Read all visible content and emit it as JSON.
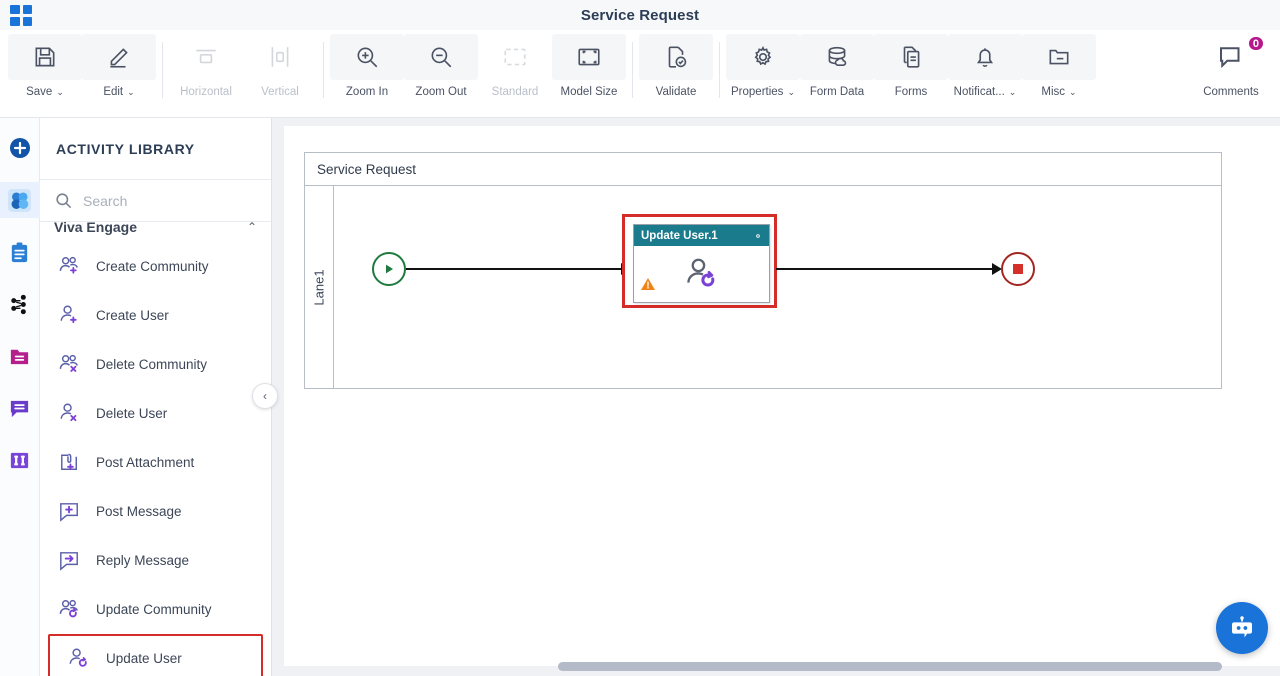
{
  "titlebar": {
    "title": "Service Request",
    "logo_icon": "app-grid-icon"
  },
  "toolbar": {
    "items": [
      {
        "label": "Save",
        "icon": "save-floppy-icon",
        "caret": "⌄",
        "disabled": false
      },
      {
        "label": "Edit",
        "icon": "pencil-icon",
        "caret": "⌄",
        "disabled": false
      },
      {
        "label": "Horizontal",
        "icon": "horizontal-align-icon",
        "caret": "",
        "disabled": true
      },
      {
        "label": "Vertical",
        "icon": "vertical-align-icon",
        "caret": "",
        "disabled": true
      },
      {
        "label": "Zoom In",
        "icon": "zoom-in-icon",
        "caret": "",
        "disabled": false
      },
      {
        "label": "Zoom Out",
        "icon": "zoom-out-icon",
        "caret": "",
        "disabled": false
      },
      {
        "label": "Standard",
        "icon": "standard-size-icon",
        "caret": "",
        "disabled": true
      },
      {
        "label": "Model Size",
        "icon": "model-size-icon",
        "caret": "",
        "disabled": false
      },
      {
        "label": "Validate",
        "icon": "validate-check-icon",
        "caret": "",
        "disabled": false
      },
      {
        "label": "Properties",
        "icon": "gear-icon",
        "caret": "⌄",
        "disabled": false
      },
      {
        "label": "Form Data",
        "icon": "database-cloud-icon",
        "caret": "",
        "disabled": false
      },
      {
        "label": "Forms",
        "icon": "document-copy-icon",
        "caret": "",
        "disabled": false
      },
      {
        "label": "Notificat...",
        "icon": "bell-icon",
        "caret": "⌄",
        "disabled": false
      },
      {
        "label": "Misc",
        "icon": "folder-minus-icon",
        "caret": "⌄",
        "disabled": false
      }
    ],
    "comments": {
      "label": "Comments",
      "icon": "comment-bubble-icon",
      "badge": "0",
      "badge_color": "#b6178d"
    }
  },
  "rail": {
    "items": [
      {
        "name": "add-new",
        "icon": "plus-circle-icon",
        "active": false
      },
      {
        "name": "community",
        "icon": "community-people-icon",
        "active": true
      },
      {
        "name": "tasks",
        "icon": "clipboard-icon",
        "active": false
      },
      {
        "name": "process",
        "icon": "workflow-nodes-icon",
        "active": false
      },
      {
        "name": "documents",
        "icon": "folder-icon",
        "active": false
      },
      {
        "name": "messages",
        "icon": "chat-bubble-icon",
        "active": false
      },
      {
        "name": "columns",
        "icon": "columns-icon",
        "active": false
      }
    ]
  },
  "panel": {
    "title": "ACTIVITY LIBRARY",
    "search": {
      "placeholder": "Search",
      "value": "",
      "icon": "search-icon"
    },
    "category": {
      "label": "Viva Engage",
      "chevron": "⌃"
    },
    "activities": [
      {
        "label": "Create Community",
        "icon": "create-community-icon",
        "selected": false
      },
      {
        "label": "Create User",
        "icon": "create-user-icon",
        "selected": false
      },
      {
        "label": "Delete Community",
        "icon": "delete-community-icon",
        "selected": false
      },
      {
        "label": "Delete User",
        "icon": "delete-user-icon",
        "selected": false
      },
      {
        "label": "Post Attachment",
        "icon": "post-attachment-icon",
        "selected": false
      },
      {
        "label": "Post Message",
        "icon": "post-message-icon",
        "selected": false
      },
      {
        "label": "Reply Message",
        "icon": "reply-message-icon",
        "selected": false
      },
      {
        "label": "Update Community",
        "icon": "update-community-icon",
        "selected": false
      },
      {
        "label": "Update User",
        "icon": "update-user-icon",
        "selected": true
      }
    ],
    "collapse_chevron": "‹"
  },
  "canvas": {
    "pool_title": "Service Request",
    "lane_label": "Lane1",
    "start_event": {
      "icon": "start-event-play-icon",
      "color": "#1f7a3f"
    },
    "end_event": {
      "icon": "end-event-stop-icon",
      "color": "#a32721"
    },
    "task": {
      "name": "Update User.1",
      "header_color": "#1a7b8c",
      "gear_icon": "gear-icon",
      "warning_icon": "warning-triangle-icon",
      "body_icon": "update-user-icon",
      "selected": true,
      "selection_color": "#d42c27"
    }
  },
  "fab": {
    "icon": "chatbot-robot-icon",
    "color": "#1a73d8"
  }
}
